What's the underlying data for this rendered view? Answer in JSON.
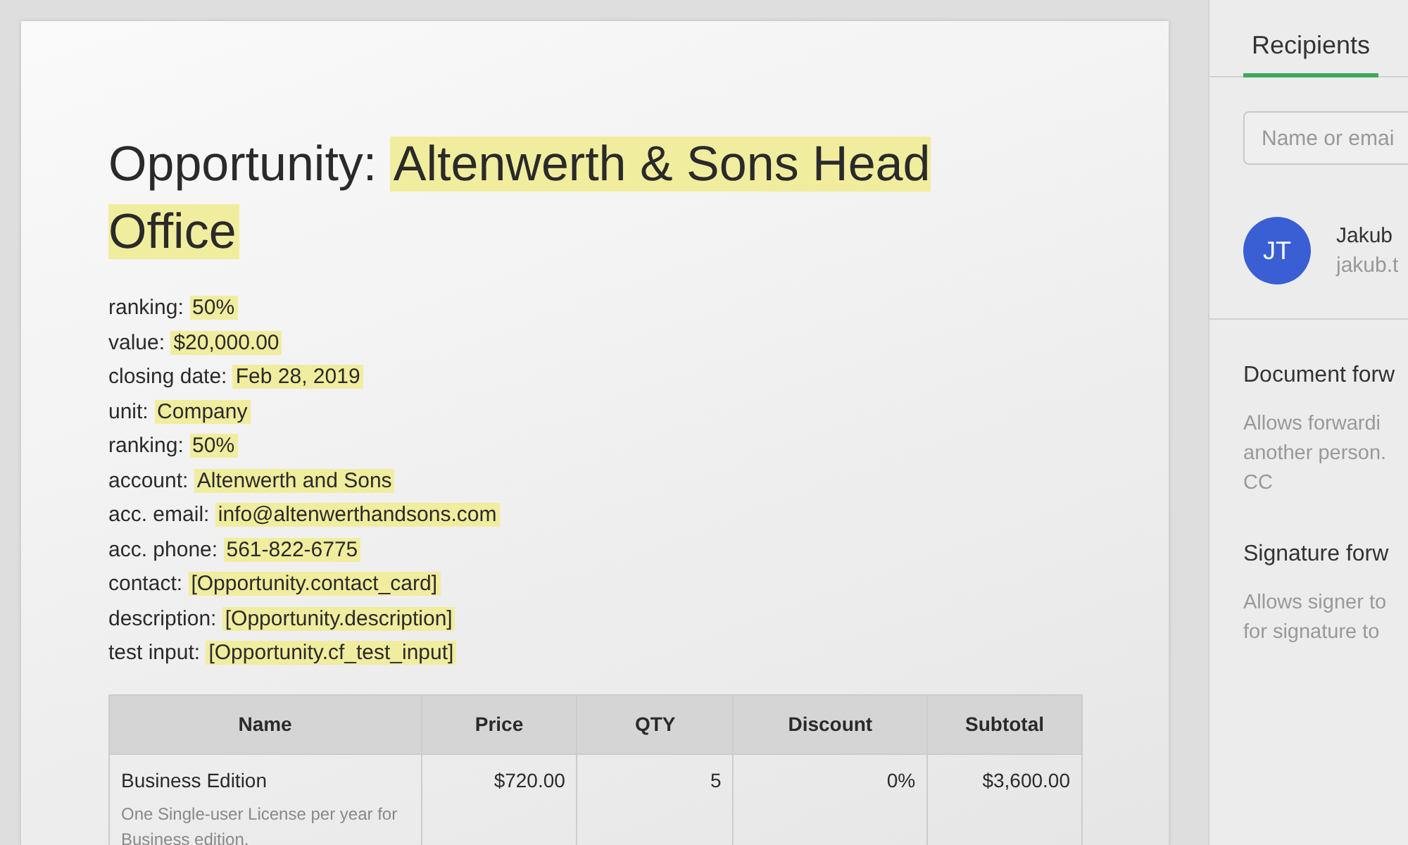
{
  "document": {
    "title": {
      "label": "Opportunity:",
      "value": "Altenwerth & Sons Head Office"
    },
    "fields": [
      {
        "label": "ranking:",
        "value": "50%"
      },
      {
        "label": "value:",
        "value": "$20,000.00"
      },
      {
        "label": "closing date:",
        "value": "Feb 28, 2019"
      },
      {
        "label": "unit:",
        "value": "Company"
      },
      {
        "label": "ranking:",
        "value": "50%"
      },
      {
        "label": "account:",
        "value": "Altenwerth and Sons"
      },
      {
        "label": "acc. email:",
        "value": "info@altenwerthandsons.com"
      },
      {
        "label": "acc. phone:",
        "value": "561-822-6775"
      },
      {
        "label": "contact:",
        "value": "[Opportunity.contact_card]"
      },
      {
        "label": "description:",
        "value": "[Opportunity.description]"
      },
      {
        "label": "test input:",
        "value": "[Opportunity.cf_test_input]"
      }
    ],
    "table": {
      "columns": [
        "Name",
        "Price",
        "QTY",
        "Discount",
        "Subtotal"
      ],
      "rows": [
        {
          "name": "Business Edition",
          "description": "One Single-user License per year for Business edition.",
          "price": "$720.00",
          "qty": "5",
          "discount": "0%",
          "subtotal": "$3,600.00"
        }
      ]
    }
  },
  "panel": {
    "tabs": [
      {
        "label": "Recipients",
        "selected": true
      }
    ],
    "search": {
      "placeholder": "Name or emai"
    },
    "recipients": [
      {
        "initials": "JT",
        "name": "Jakub",
        "email": "jakub.t"
      }
    ],
    "sections": [
      {
        "title": "Document forw",
        "description": [
          "Allows forwardi",
          "another person.",
          "CC"
        ]
      },
      {
        "title": "Signature forw",
        "description": [
          "Allows signer to",
          "for signature to"
        ]
      }
    ]
  }
}
